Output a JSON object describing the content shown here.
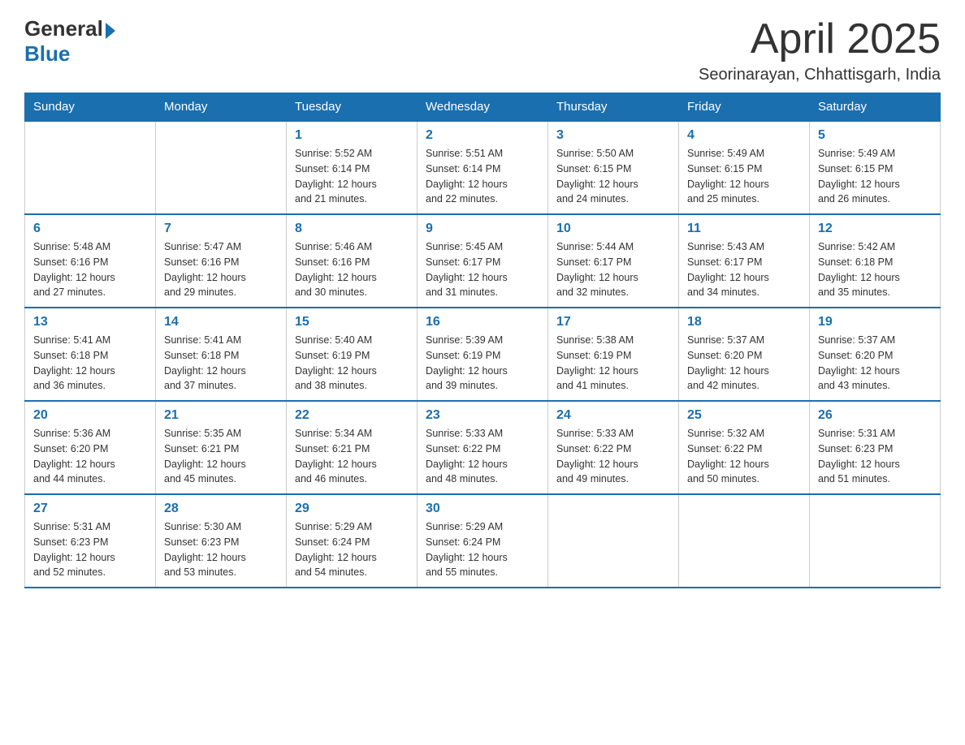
{
  "header": {
    "logo_general": "General",
    "logo_blue": "Blue",
    "month_title": "April 2025",
    "location": "Seorinarayan, Chhattisgarh, India"
  },
  "days_of_week": [
    "Sunday",
    "Monday",
    "Tuesday",
    "Wednesday",
    "Thursday",
    "Friday",
    "Saturday"
  ],
  "weeks": [
    {
      "days": [
        {
          "num": "",
          "info": ""
        },
        {
          "num": "",
          "info": ""
        },
        {
          "num": "1",
          "info": "Sunrise: 5:52 AM\nSunset: 6:14 PM\nDaylight: 12 hours\nand 21 minutes."
        },
        {
          "num": "2",
          "info": "Sunrise: 5:51 AM\nSunset: 6:14 PM\nDaylight: 12 hours\nand 22 minutes."
        },
        {
          "num": "3",
          "info": "Sunrise: 5:50 AM\nSunset: 6:15 PM\nDaylight: 12 hours\nand 24 minutes."
        },
        {
          "num": "4",
          "info": "Sunrise: 5:49 AM\nSunset: 6:15 PM\nDaylight: 12 hours\nand 25 minutes."
        },
        {
          "num": "5",
          "info": "Sunrise: 5:49 AM\nSunset: 6:15 PM\nDaylight: 12 hours\nand 26 minutes."
        }
      ]
    },
    {
      "days": [
        {
          "num": "6",
          "info": "Sunrise: 5:48 AM\nSunset: 6:16 PM\nDaylight: 12 hours\nand 27 minutes."
        },
        {
          "num": "7",
          "info": "Sunrise: 5:47 AM\nSunset: 6:16 PM\nDaylight: 12 hours\nand 29 minutes."
        },
        {
          "num": "8",
          "info": "Sunrise: 5:46 AM\nSunset: 6:16 PM\nDaylight: 12 hours\nand 30 minutes."
        },
        {
          "num": "9",
          "info": "Sunrise: 5:45 AM\nSunset: 6:17 PM\nDaylight: 12 hours\nand 31 minutes."
        },
        {
          "num": "10",
          "info": "Sunrise: 5:44 AM\nSunset: 6:17 PM\nDaylight: 12 hours\nand 32 minutes."
        },
        {
          "num": "11",
          "info": "Sunrise: 5:43 AM\nSunset: 6:17 PM\nDaylight: 12 hours\nand 34 minutes."
        },
        {
          "num": "12",
          "info": "Sunrise: 5:42 AM\nSunset: 6:18 PM\nDaylight: 12 hours\nand 35 minutes."
        }
      ]
    },
    {
      "days": [
        {
          "num": "13",
          "info": "Sunrise: 5:41 AM\nSunset: 6:18 PM\nDaylight: 12 hours\nand 36 minutes."
        },
        {
          "num": "14",
          "info": "Sunrise: 5:41 AM\nSunset: 6:18 PM\nDaylight: 12 hours\nand 37 minutes."
        },
        {
          "num": "15",
          "info": "Sunrise: 5:40 AM\nSunset: 6:19 PM\nDaylight: 12 hours\nand 38 minutes."
        },
        {
          "num": "16",
          "info": "Sunrise: 5:39 AM\nSunset: 6:19 PM\nDaylight: 12 hours\nand 39 minutes."
        },
        {
          "num": "17",
          "info": "Sunrise: 5:38 AM\nSunset: 6:19 PM\nDaylight: 12 hours\nand 41 minutes."
        },
        {
          "num": "18",
          "info": "Sunrise: 5:37 AM\nSunset: 6:20 PM\nDaylight: 12 hours\nand 42 minutes."
        },
        {
          "num": "19",
          "info": "Sunrise: 5:37 AM\nSunset: 6:20 PM\nDaylight: 12 hours\nand 43 minutes."
        }
      ]
    },
    {
      "days": [
        {
          "num": "20",
          "info": "Sunrise: 5:36 AM\nSunset: 6:20 PM\nDaylight: 12 hours\nand 44 minutes."
        },
        {
          "num": "21",
          "info": "Sunrise: 5:35 AM\nSunset: 6:21 PM\nDaylight: 12 hours\nand 45 minutes."
        },
        {
          "num": "22",
          "info": "Sunrise: 5:34 AM\nSunset: 6:21 PM\nDaylight: 12 hours\nand 46 minutes."
        },
        {
          "num": "23",
          "info": "Sunrise: 5:33 AM\nSunset: 6:22 PM\nDaylight: 12 hours\nand 48 minutes."
        },
        {
          "num": "24",
          "info": "Sunrise: 5:33 AM\nSunset: 6:22 PM\nDaylight: 12 hours\nand 49 minutes."
        },
        {
          "num": "25",
          "info": "Sunrise: 5:32 AM\nSunset: 6:22 PM\nDaylight: 12 hours\nand 50 minutes."
        },
        {
          "num": "26",
          "info": "Sunrise: 5:31 AM\nSunset: 6:23 PM\nDaylight: 12 hours\nand 51 minutes."
        }
      ]
    },
    {
      "days": [
        {
          "num": "27",
          "info": "Sunrise: 5:31 AM\nSunset: 6:23 PM\nDaylight: 12 hours\nand 52 minutes."
        },
        {
          "num": "28",
          "info": "Sunrise: 5:30 AM\nSunset: 6:23 PM\nDaylight: 12 hours\nand 53 minutes."
        },
        {
          "num": "29",
          "info": "Sunrise: 5:29 AM\nSunset: 6:24 PM\nDaylight: 12 hours\nand 54 minutes."
        },
        {
          "num": "30",
          "info": "Sunrise: 5:29 AM\nSunset: 6:24 PM\nDaylight: 12 hours\nand 55 minutes."
        },
        {
          "num": "",
          "info": ""
        },
        {
          "num": "",
          "info": ""
        },
        {
          "num": "",
          "info": ""
        }
      ]
    }
  ]
}
